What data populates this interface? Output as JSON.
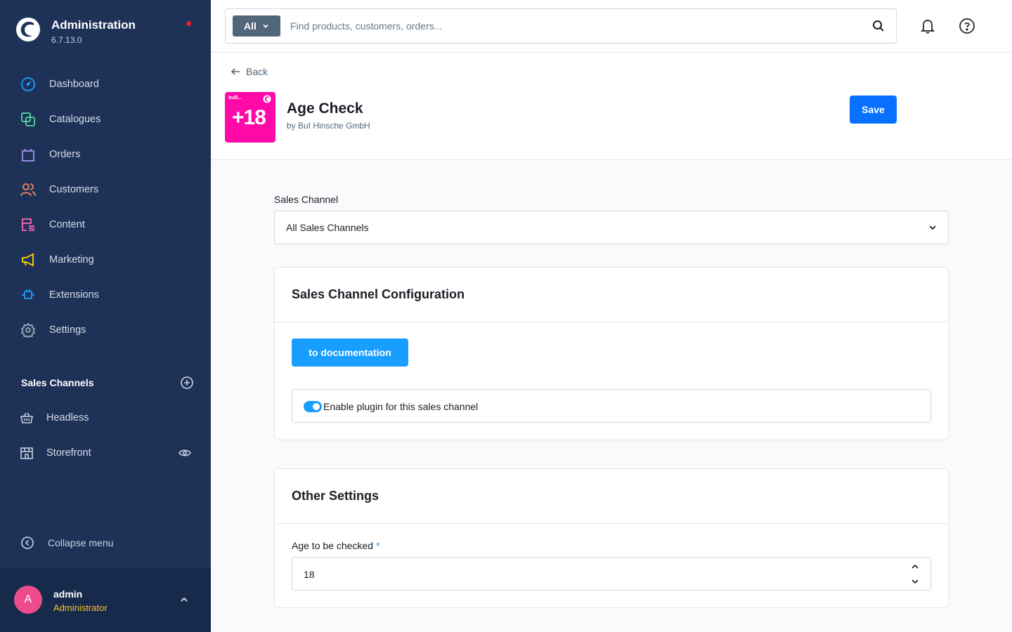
{
  "app": {
    "title": "Administration",
    "version": "6.7.13.0"
  },
  "sidebar": {
    "items": [
      {
        "label": "Dashboard",
        "icon": "dashboard-icon",
        "color": "#189eff"
      },
      {
        "label": "Catalogues",
        "icon": "catalogues-icon",
        "color": "#57d9a3"
      },
      {
        "label": "Orders",
        "icon": "orders-icon",
        "color": "#a092f0"
      },
      {
        "label": "Customers",
        "icon": "customers-icon",
        "color": "#f88962"
      },
      {
        "label": "Content",
        "icon": "content-icon",
        "color": "#ff68b4"
      },
      {
        "label": "Marketing",
        "icon": "marketing-icon",
        "color": "#ffd700"
      },
      {
        "label": "Extensions",
        "icon": "extensions-icon",
        "color": "#189eff"
      },
      {
        "label": "Settings",
        "icon": "settings-icon",
        "color": "#9aa8b5"
      }
    ],
    "sales_channels_title": "Sales Channels",
    "sales_channels": [
      {
        "label": "Headless",
        "icon": "basket-icon"
      },
      {
        "label": "Storefront",
        "icon": "storefront-icon"
      }
    ],
    "collapse_label": "Collapse menu"
  },
  "user": {
    "initial": "A",
    "name": "admin",
    "role": "Administrator"
  },
  "search": {
    "type_label": "All",
    "placeholder": "Find products, customers, orders..."
  },
  "header": {
    "back_label": "Back",
    "plugin_title": "Age Check",
    "plugin_vendor": "by BuI Hinsche GmbH",
    "logo_text": "+18",
    "logo_mini_text": "buB...",
    "save_label": "Save"
  },
  "content": {
    "sales_channel_label": "Sales Channel",
    "sales_channel_value": "All Sales Channels",
    "config_card": {
      "title": "Sales Channel Configuration",
      "doc_button": "to documentation",
      "switch_label": "Enable plugin for this sales channel",
      "switch_on": true
    },
    "other_card": {
      "title": "Other Settings",
      "age_label": "Age to be checked",
      "required_mark": "*",
      "age_value": "18"
    }
  },
  "colors": {
    "sidebar_bg": "#1e3258",
    "accent": "#189eff",
    "save": "#0870ff",
    "plugin_logo": "#ff0aa8",
    "notification_dot": "#e5213b"
  }
}
